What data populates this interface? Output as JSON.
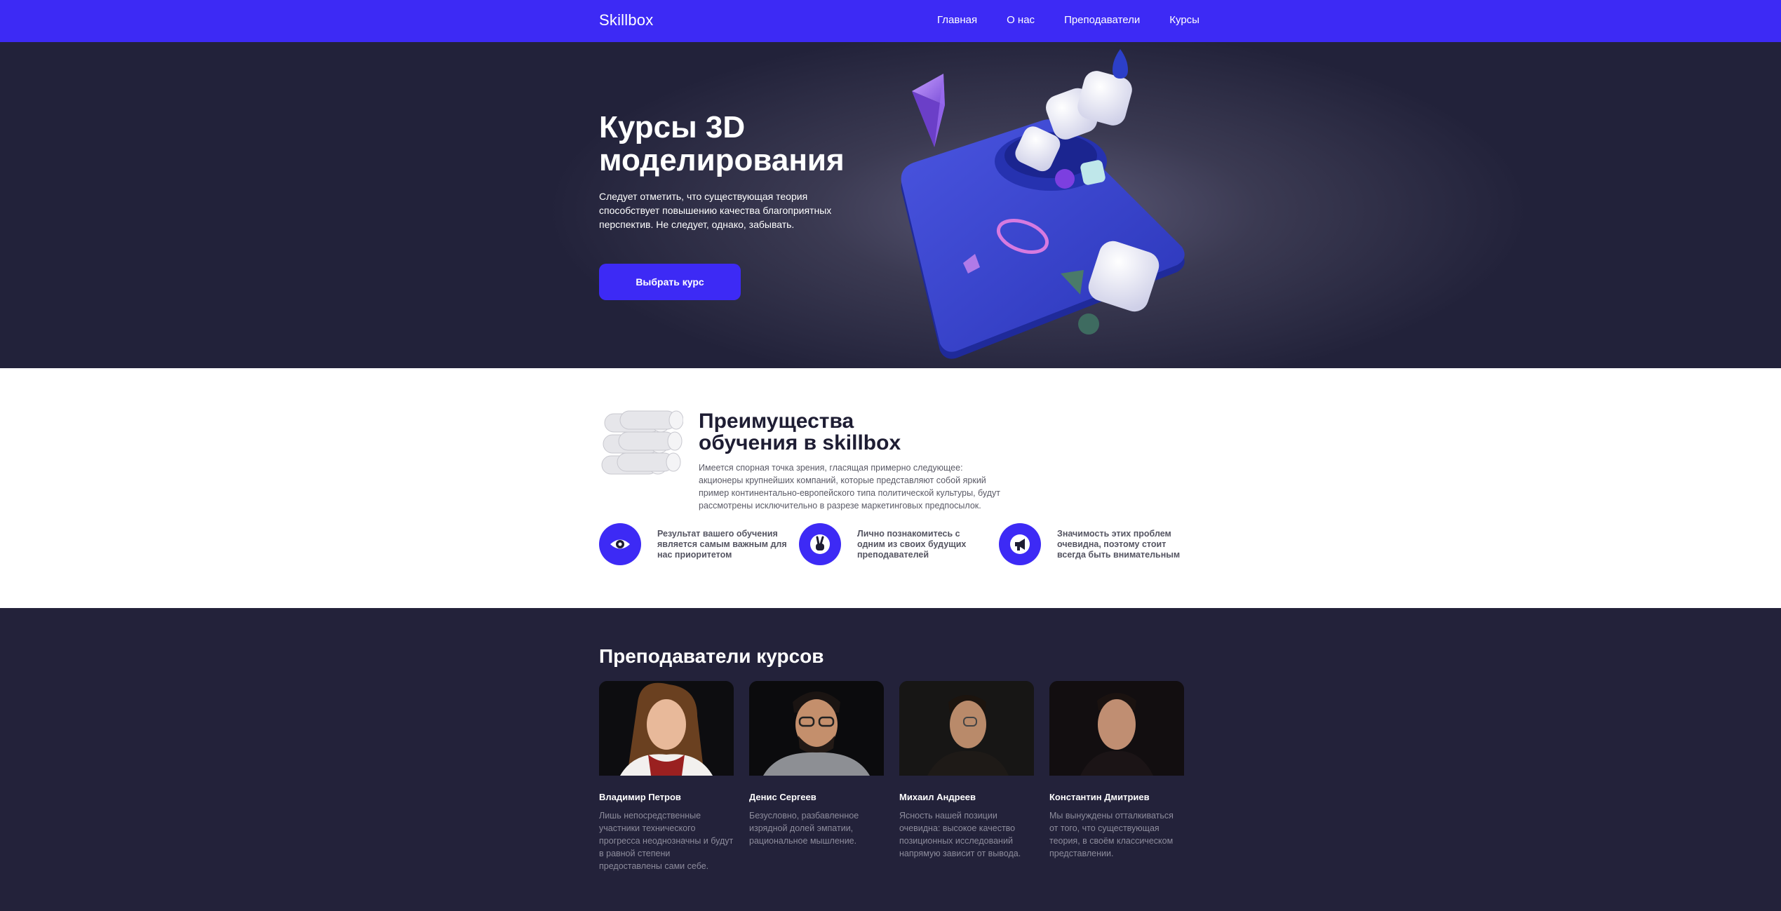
{
  "header": {
    "logo": "Skillbox",
    "nav": [
      "Главная",
      "О нас",
      "Преподаватели",
      "Курсы"
    ]
  },
  "hero": {
    "title": "Курсы 3D моделирования",
    "text": "Следует отметить, что существующая теория способствует повышению качества благоприятных перспектив. Не следует, однако, забывать.",
    "button": "Выбрать курс"
  },
  "advantages": {
    "title": "Преимущества обучения в skillbox",
    "text": "Имеется спорная точка зрения, гласящая примерно следующее: акционеры крупнейших компаний, которые представляют собой яркий пример континентально-европейского типа политической культуры, будут рассмотрены исключительно в разрезе маркетинговых предпосылок.",
    "features": [
      {
        "icon": "eye-icon",
        "text": "Результат вашего обучения является самым важным для нас приоритетом"
      },
      {
        "icon": "peace-hand-icon",
        "text": "Лично познакомитесь с одним из своих будущих преподавателей"
      },
      {
        "icon": "megaphone-icon",
        "text": "Значимость этих проблем очевидна, поэтому стоит всегда быть внимательным"
      }
    ]
  },
  "teachers": {
    "title": "Преподаватели курсов",
    "items": [
      {
        "name": "Владимир Петров",
        "desc": "Лишь непосредственные участники технического прогресса неоднозначны и будут в равной степени предоставлены сами себе."
      },
      {
        "name": "Денис Сергеев",
        "desc": "Безусловно, разбавленное изрядной долей эмпатии, рациональное мышление."
      },
      {
        "name": "Михаил Андреев",
        "desc": "Ясность нашей позиции очевидна: высокое качество позиционных исследований напрямую зависит от вывода."
      },
      {
        "name": "Константин Дмитриев",
        "desc": "Мы вынуждены отталкиваться от того, что существующая теория, в своём классическом представлении."
      }
    ]
  },
  "colors": {
    "accent": "#3d2af5",
    "dark": "#23223a",
    "white": "#ffffff"
  }
}
